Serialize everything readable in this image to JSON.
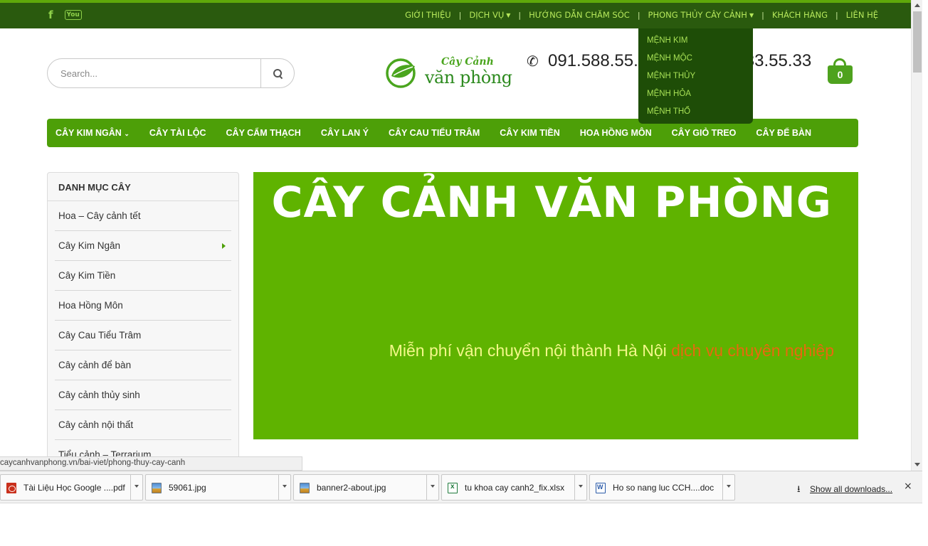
{
  "topbar": {
    "social": {
      "facebook_glyph": "f",
      "youtube_glyph": "You"
    },
    "nav": [
      {
        "label": "GIỚI THIỆU",
        "dropdown": false
      },
      {
        "label": "DỊCH VỤ",
        "dropdown": true
      },
      {
        "label": "HƯỚNG DẪN CHĂM SÓC",
        "dropdown": false
      },
      {
        "label": "PHONG THỦY CÂY CẢNH",
        "dropdown": true
      },
      {
        "label": "KHÁCH HÀNG",
        "dropdown": false
      },
      {
        "label": "LIÊN HỆ",
        "dropdown": false
      }
    ],
    "separator": "|"
  },
  "dropdown": {
    "items": [
      "MỆNH KIM",
      "MỆNH MỘC",
      "MỆNH THỦY",
      "MỆNH HỎA",
      "MỆNH THỔ"
    ]
  },
  "search": {
    "placeholder": "Search..."
  },
  "logo": {
    "top": "Cây Cảnh",
    "main": "văn phòng"
  },
  "phone": {
    "number": "091.588.55.",
    "number2": "33.55.33"
  },
  "cart": {
    "count": "0"
  },
  "mainnav": {
    "items": [
      {
        "label": "CÂY KIM NGÂN",
        "dropdown": true
      },
      {
        "label": "CÂY TÀI LỘC",
        "dropdown": false
      },
      {
        "label": "CÂY CẨM THẠCH",
        "dropdown": false
      },
      {
        "label": "CÂY LAN Ý",
        "dropdown": false
      },
      {
        "label": "CÂY CAU TIỂU TRÂM",
        "dropdown": false
      },
      {
        "label": "CÂY KIM TIỀN",
        "dropdown": false
      },
      {
        "label": "HOA HỒNG MÔN",
        "dropdown": false
      },
      {
        "label": "CÂY GIỎ TREO",
        "dropdown": false
      },
      {
        "label": "CÂY ĐỂ BÀN",
        "dropdown": false
      }
    ]
  },
  "sidebar": {
    "title": "DANH MỤC CÂY",
    "items": [
      {
        "label": "Hoa – Cây cảnh tết",
        "has_sub": false
      },
      {
        "label": "Cây Kim Ngân",
        "has_sub": true
      },
      {
        "label": "Cây Kim Tiền",
        "has_sub": false
      },
      {
        "label": "Hoa Hồng Môn",
        "has_sub": false
      },
      {
        "label": "Cây Cau Tiểu Trâm",
        "has_sub": false
      },
      {
        "label": "Cây cảnh để bàn",
        "has_sub": false
      },
      {
        "label": "Cây cảnh thủy sinh",
        "has_sub": false
      },
      {
        "label": "Cây cảnh nội thất",
        "has_sub": false
      },
      {
        "label": "Tiểu cảnh – Terrarium",
        "has_sub": false
      }
    ]
  },
  "banner": {
    "title": "CÂY CẢNH VĂN PHÒNG",
    "subtitle": "Miễn phí vận chuyển nội thành Hà Nội",
    "highlight": "dịch vụ chuyên nghiệp"
  },
  "status_url": "caycanhvanphong.vn/bai-viet/phong-thuy-cay-canh",
  "downloads": {
    "items": [
      {
        "name": "Tài Liệu Học Google ....pdf",
        "icon": "pdf-icon"
      },
      {
        "name": "59061.jpg",
        "icon": "image-icon"
      },
      {
        "name": "banner2-about.jpg",
        "icon": "image-icon"
      },
      {
        "name": "tu khoa cay canh2_fix.xlsx",
        "icon": "excel-icon"
      },
      {
        "name": "Ho so nang luc CCH....doc",
        "icon": "word-icon"
      }
    ],
    "show_all": "Show all downloads...",
    "close_glyph": "×"
  },
  "colors": {
    "topbar": "#2a5a0e",
    "nav_green": "#4d9f08",
    "banner_green": "#5fb300",
    "accent_text": "#b6e85b",
    "highlight_orange": "#e8690f"
  }
}
